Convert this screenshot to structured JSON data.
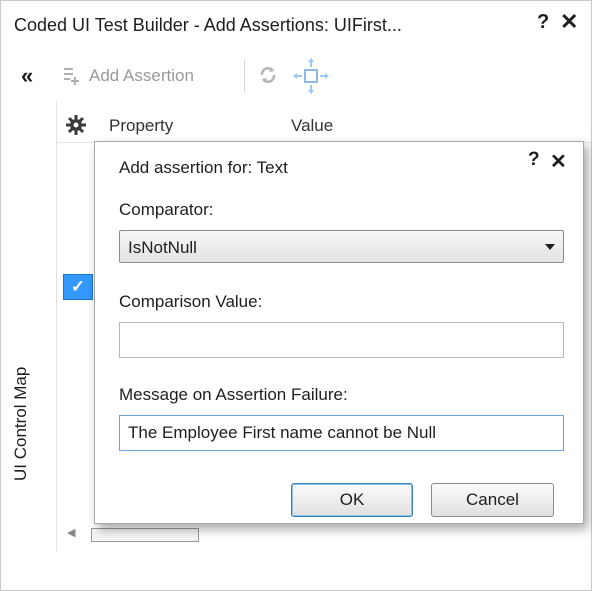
{
  "window": {
    "title": "Coded UI Test Builder - Add Assertions: UIFirst...",
    "help_glyph": "?",
    "close_glyph": "✕"
  },
  "toolbar": {
    "collapse_glyph": "«",
    "add_assertion_label": "Add Assertion"
  },
  "sidebar": {
    "tab_label": "UI Control Map"
  },
  "grid": {
    "columns": [
      "Property",
      "Value"
    ],
    "selected_check_glyph": "✓"
  },
  "dialog": {
    "title": "Add assertion for: Text",
    "help_glyph": "?",
    "close_glyph": "✕",
    "comparator_label": "Comparator:",
    "comparator_value": "IsNotNull",
    "comparison_value_label": "Comparison Value:",
    "comparison_value": "",
    "message_label": "Message on Assertion Failure:",
    "message_value": "The Employee First name cannot be Null",
    "ok_label": "OK",
    "cancel_label": "Cancel"
  },
  "colors": {
    "selection_blue": "#3399ff",
    "disabled_text": "#9a9a9a",
    "focus_border": "#6ca0d8"
  },
  "icons": [
    "gear-icon",
    "refresh-icon",
    "locate-crosshair-icon",
    "add-assertion-icon",
    "collapse-icon"
  ]
}
